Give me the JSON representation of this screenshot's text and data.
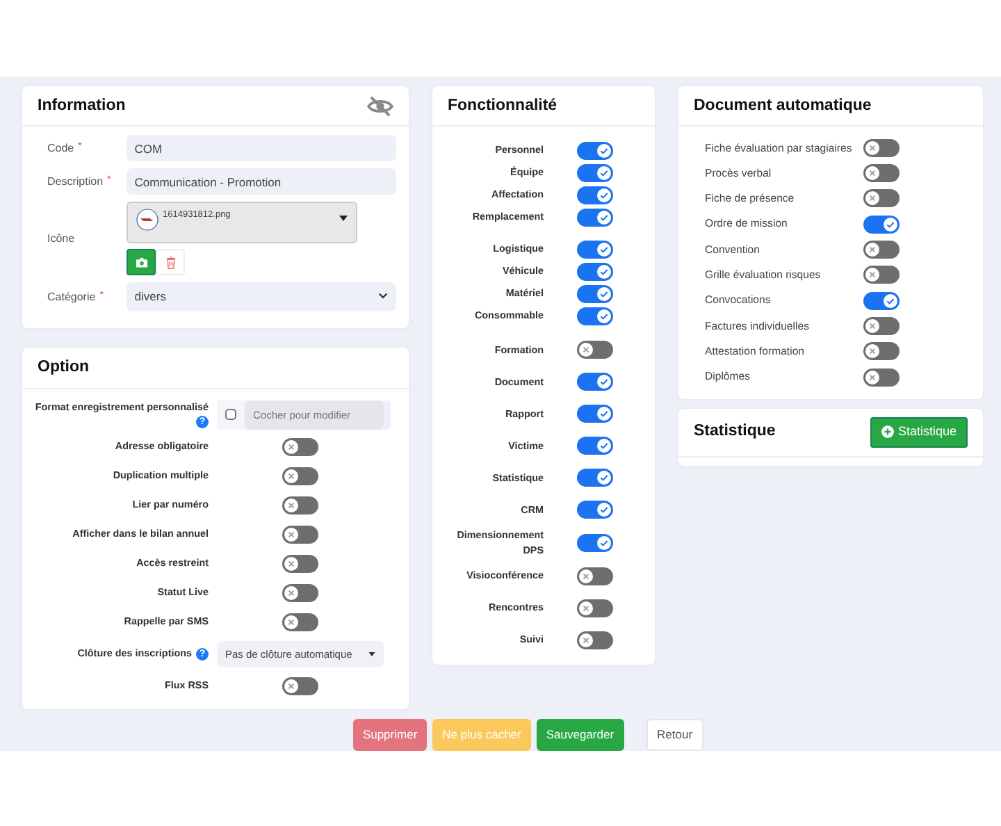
{
  "information": {
    "title": "Information",
    "fields": [
      {
        "label": "Code",
        "required_mark": "*",
        "kind": "text",
        "value": "COM"
      },
      {
        "label": "Description",
        "required_mark": "*",
        "kind": "text",
        "value": "Communication - Promotion"
      },
      {
        "label": "Icône",
        "kind": "file",
        "value": "1614931812.png"
      },
      {
        "label": "Catégorie",
        "required_mark": "*",
        "kind": "select",
        "value": "divers"
      }
    ]
  },
  "option": {
    "title": "Option",
    "rows": [
      {
        "kind": "checkfield",
        "label": "Format enregistrement personnalisé",
        "help": "?",
        "checked": false,
        "placeholder": "Cocher pour modifier"
      },
      {
        "kind": "switch",
        "label": "Adresse obligatoire",
        "on": false
      },
      {
        "kind": "switch",
        "label": "Duplication multiple",
        "on": false
      },
      {
        "kind": "switch",
        "label": "Lier par numéro",
        "on": false
      },
      {
        "kind": "switch",
        "label": "Afficher dans le bilan annuel",
        "on": false
      },
      {
        "kind": "switch",
        "label": "Accès restreint",
        "on": false
      },
      {
        "kind": "switch",
        "label": "Statut Live",
        "on": false
      },
      {
        "kind": "switch",
        "label": "Rappelle par SMS",
        "on": false
      },
      {
        "kind": "select",
        "label": "Clôture des inscriptions",
        "help": "?",
        "value": "Pas de clôture automatique"
      },
      {
        "kind": "switch",
        "label": "Flux RSS",
        "on": false
      }
    ]
  },
  "fonctionnalite": {
    "title": "Fonctionnalité",
    "groups": [
      [
        {
          "label": "Personnel",
          "on": true
        },
        {
          "label": "Équipe",
          "on": true
        },
        {
          "label": "Affectation",
          "on": true
        },
        {
          "label": "Remplacement",
          "on": true
        }
      ],
      [
        {
          "label": "Logistique",
          "on": true
        },
        {
          "label": "Véhicule",
          "on": true
        },
        {
          "label": "Matériel",
          "on": true
        },
        {
          "label": "Consommable",
          "on": true
        }
      ],
      [
        {
          "label": "Formation",
          "on": false
        }
      ],
      [
        {
          "label": "Document",
          "on": true
        }
      ],
      [
        {
          "label": "Rapport",
          "on": true
        }
      ],
      [
        {
          "label": "Victime",
          "on": true
        }
      ],
      [
        {
          "label": "Statistique",
          "on": true
        }
      ],
      [
        {
          "label": "CRM",
          "on": true
        }
      ],
      [
        {
          "label": "Dimensionnement DPS",
          "on": true
        }
      ],
      [
        {
          "label": "Visioconférence",
          "on": false
        }
      ],
      [
        {
          "label": "Rencontres",
          "on": false
        }
      ],
      [
        {
          "label": "Suivi",
          "on": false
        }
      ]
    ]
  },
  "document_automatique": {
    "title": "Document automatique",
    "items": [
      {
        "label": "Fiche évaluation par stagiaires",
        "on": false
      },
      {
        "label": "Procès verbal",
        "on": false
      },
      {
        "label": "Fiche de présence",
        "on": false
      },
      {
        "label": "Ordre de mission",
        "on": true
      },
      {
        "label": "Convention",
        "on": false
      },
      {
        "label": "Grille évaluation risques",
        "on": false
      },
      {
        "label": "Convocations",
        "on": true
      },
      {
        "label": "Factures individuelles",
        "on": false
      },
      {
        "label": "Attestation formation",
        "on": false
      },
      {
        "label": "Diplômes",
        "on": false
      }
    ]
  },
  "statistique": {
    "title": "Statistique",
    "button": "Statistique"
  },
  "actions": [
    {
      "label": "Supprimer",
      "kind": "danger"
    },
    {
      "label": "Ne plus cacher",
      "kind": "warning"
    },
    {
      "label": "Sauvegarder",
      "kind": "success"
    },
    {
      "label": "Retour",
      "kind": "light"
    }
  ]
}
